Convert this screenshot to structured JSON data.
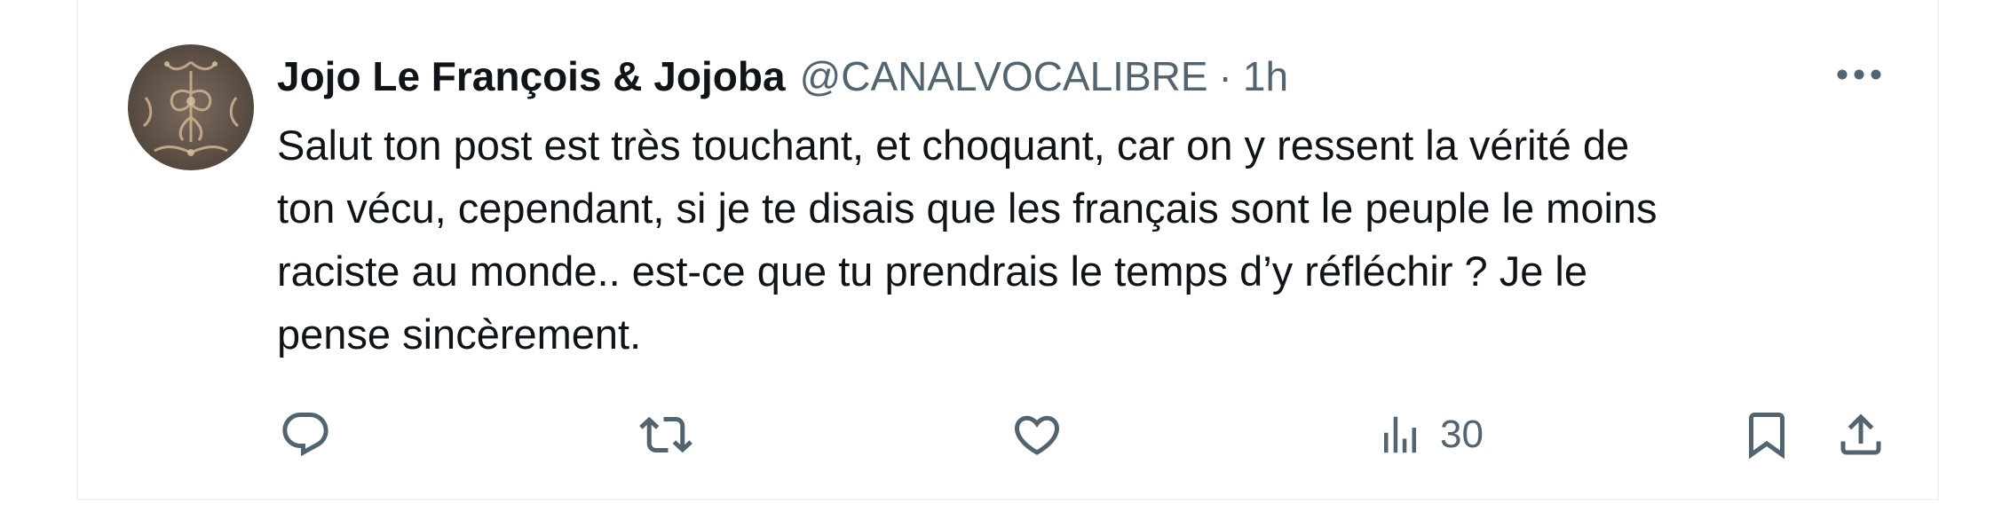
{
  "tweet": {
    "display_name": "Jojo Le François & Jojoba",
    "handle": "@CANALVOCALIBRE",
    "separator": "·",
    "time": "1h",
    "text_lines": [
      "Salut ton post est très touchant, et choquant, car on y ressent la vérité de",
      "ton vécu, cependant, si je te disais que les français sont le peuple le moins",
      "raciste au monde.. est-ce que tu prendrais le temps d’y réfléchir ? Je le",
      "pense sincèrement."
    ],
    "views_count": "30"
  },
  "icons": {
    "more": "more-horizontal-icon",
    "reply": "reply-icon",
    "repost": "repost-icon",
    "like": "heart-icon",
    "views": "views-icon",
    "bookmark": "bookmark-icon",
    "share": "share-icon"
  },
  "colors": {
    "text_primary": "#0f1419",
    "text_secondary": "#536471",
    "border": "#eff3f4"
  }
}
